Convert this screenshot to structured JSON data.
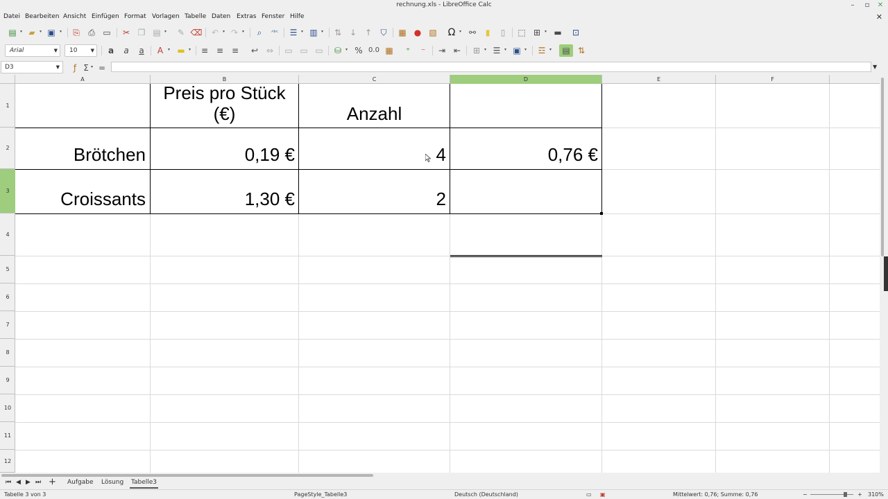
{
  "window": {
    "title": "rechnung.xls - LibreOffice Calc"
  },
  "menu": [
    "Datei",
    "Bearbeiten",
    "Ansicht",
    "Einfügen",
    "Format",
    "Vorlagen",
    "Tabelle",
    "Daten",
    "Extras",
    "Fenster",
    "Hilfe"
  ],
  "toolbar": {
    "font_name": "Arial",
    "font_size": "10",
    "percent_label": "%",
    "decimal_label": "0.0"
  },
  "formula_bar": {
    "name_box": "D3",
    "content": ""
  },
  "columns": [
    "A",
    "B",
    "C",
    "D",
    "E",
    "F"
  ],
  "selected_column": "D",
  "rows": [
    "1",
    "2",
    "3",
    "4",
    "5",
    "6",
    "7",
    "8",
    "9",
    "10",
    "11",
    "12"
  ],
  "selected_row": "3",
  "cells": {
    "B1_line1": "Preis pro Stück",
    "B1_line2": "(€)",
    "C1": "Anzahl",
    "A2": "Brötchen",
    "B2": "0,19 €",
    "C2": "4",
    "D2": "0,76 €",
    "A3": "Croissants",
    "B3": "1,30 €",
    "C3": "2"
  },
  "sheet_tabs": [
    "Aufgabe",
    "Lösung",
    "Tabelle3"
  ],
  "active_sheet": "Tabelle3",
  "status": {
    "sheet": "Tabelle 3 von 3",
    "page_style": "PageStyle_Tabelle3",
    "language": "Deutsch (Deutschland)",
    "sum": "Mittelwert: 0,76; Summe: 0,76",
    "zoom": "310%"
  },
  "colors": {
    "selected_header": "#9dcd7d",
    "sheet_bg": "#ffffff",
    "chrome_bg": "#efefef"
  }
}
